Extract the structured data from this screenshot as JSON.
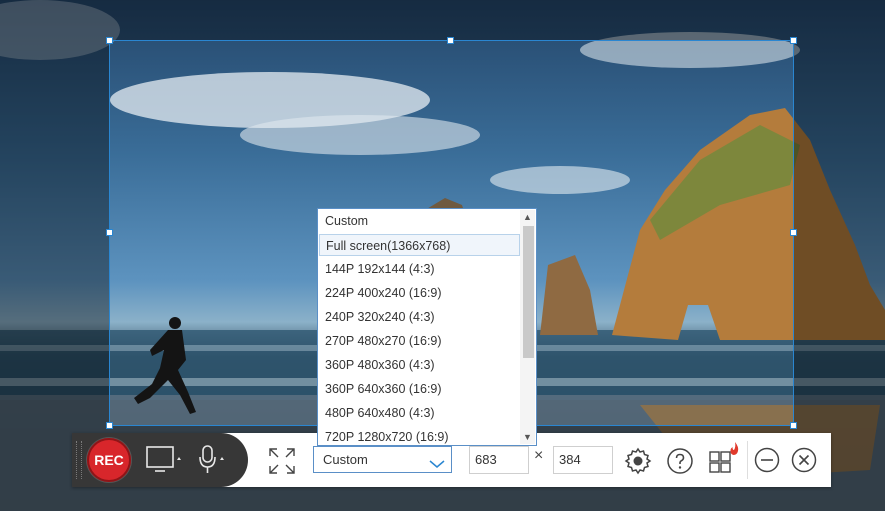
{
  "toolbar": {
    "rec_label": "REC",
    "resolution_selected": "Custom",
    "width_value": "683",
    "height_value": "384",
    "times_symbol": "×"
  },
  "dropdown": {
    "options": [
      "Custom",
      "Full screen(1366x768)",
      "144P 192x144 (4:3)",
      "224P 400x240 (16:9)",
      "240P 320x240 (4:3)",
      "270P 480x270 (16:9)",
      "360P 480x360 (4:3)",
      "360P 640x360 (16:9)",
      "480P 640x480 (4:3)",
      "720P 1280x720 (16:9)"
    ],
    "highlighted_index": 1
  },
  "colors": {
    "accent": "#2a86d1",
    "rec": "#d8262b",
    "toolbar_dark": "#373737"
  },
  "icons": [
    "display-icon",
    "microphone-icon",
    "fullscreen-icon",
    "settings-gear-icon",
    "help-icon",
    "tools-grid-icon",
    "minimize-icon",
    "close-icon"
  ]
}
